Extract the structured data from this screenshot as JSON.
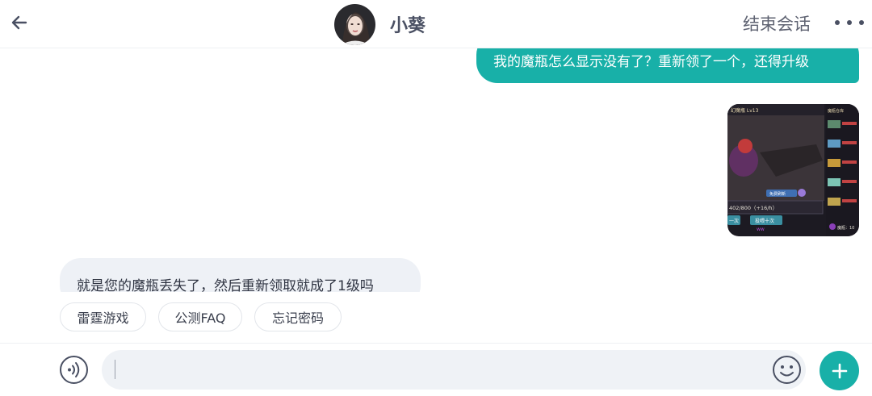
{
  "header": {
    "back_icon": "back-arrow-icon",
    "contact_name": "小葵",
    "end_chat_label": "结束会话",
    "more_icon": "more-dots-icon"
  },
  "messages": [
    {
      "from": "me",
      "type": "text",
      "text": "我的魔瓶怎么显示没有了？重新领了一个，还得升级"
    },
    {
      "from": "me",
      "type": "image",
      "image": {
        "top_left": "幻魔瓶 Lv13",
        "top_right": "魔瓶仓库",
        "progress": "402/800（+16/h）",
        "button_left": "一次",
        "button_right": "投喂十次",
        "panel_button": "免费刷新",
        "bottom_right": "魔瓶：10"
      }
    },
    {
      "from": "other",
      "type": "text",
      "text": "就是您的魔瓶丢失了，然后重新领取就成了1级吗"
    }
  ],
  "quick_replies": [
    "雷霆游戏",
    "公测FAQ",
    "忘记密码"
  ],
  "input": {
    "value": "",
    "placeholder": ""
  },
  "colors": {
    "accent": "#18b0a8",
    "bubble_other": "#eef1f6"
  }
}
